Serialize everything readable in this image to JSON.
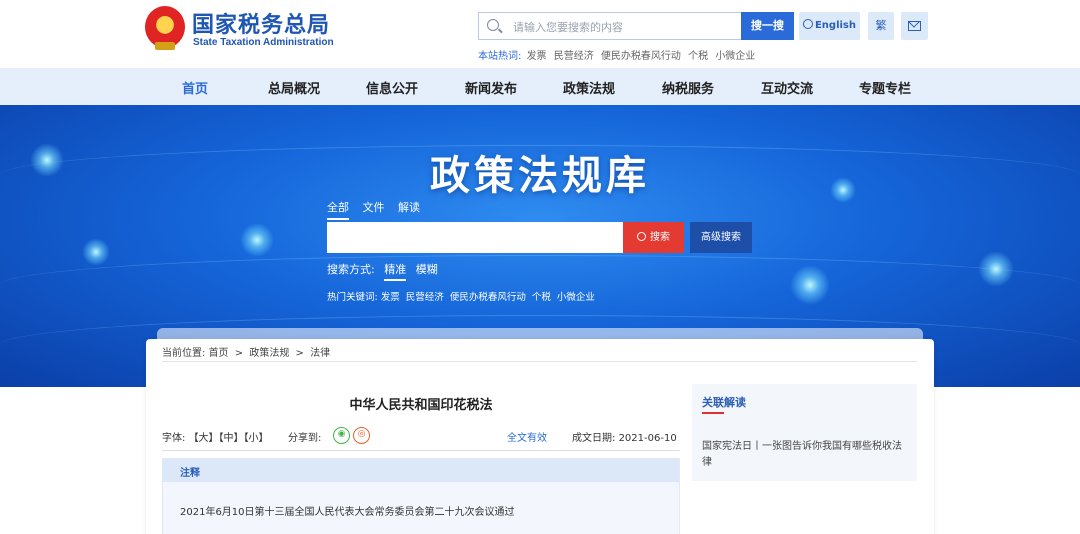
{
  "header": {
    "logo_cn": "国家税务总局",
    "logo_en": "State Taxation Administration",
    "search_placeholder": "请输入您要搜索的内容",
    "search_button": "搜一搜",
    "english_button": "English",
    "traditional_button": "繁",
    "hot_label": "本站热词:",
    "hot_words": [
      "发票",
      "民营经济",
      "便民办税春风行动",
      "个税",
      "小微企业"
    ]
  },
  "nav": {
    "items": [
      "首页",
      "总局概况",
      "信息公开",
      "新闻发布",
      "政策法规",
      "纳税服务",
      "互动交流",
      "专题专栏"
    ],
    "active_index": 0
  },
  "banner": {
    "title": "政策法规库",
    "scope_tabs": [
      "全部",
      "文件",
      "解读"
    ],
    "search_button": "搜索",
    "advanced_button": "高级搜索",
    "mode_label": "搜索方式:",
    "mode_options": [
      "精准",
      "模糊"
    ],
    "keywords_label": "热门关键词:",
    "keywords": [
      "发票",
      "民营经济",
      "便民办税春风行动",
      "个税",
      "小微企业"
    ]
  },
  "breadcrumb": {
    "label": "当前位置:",
    "items": [
      "首页",
      "政策法规",
      "法律"
    ],
    "separator": ">"
  },
  "document": {
    "title": "中华人民共和国印花税法",
    "font_label": "字体:",
    "font_options": [
      "【大】",
      "【中】",
      "【小】"
    ],
    "share_label": "分享到:",
    "validity": "全文有效",
    "date_label": "成文日期:",
    "date": "2021-06-10",
    "note_title": "注释",
    "note_text": "2021年6月10日第十三届全国人民代表大会常务委员会第二十九次会议通过"
  },
  "related": {
    "title": "关联解读",
    "link": "国家宪法日丨一张图告诉你我国有哪些税收法律"
  },
  "colors": {
    "brand_blue": "#2b6bd9",
    "search_red": "#e33a31",
    "nav_bg": "#e5eefb"
  }
}
